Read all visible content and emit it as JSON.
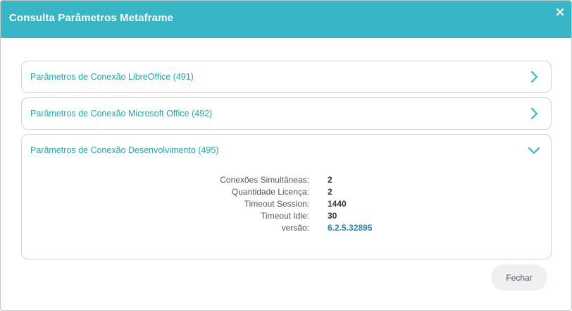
{
  "modal": {
    "title": "Consulta Parâmetros Metaframe",
    "close_icon": "close-icon",
    "accent_color": "#38b6c5"
  },
  "panels": [
    {
      "title": "Parâmetros de Conexão LibreOffice (491)",
      "state": "collapsed",
      "icon": "chevron-right-icon"
    },
    {
      "title": "Parâmetros de Conexão Microsoft Office (492)",
      "state": "collapsed",
      "icon": "chevron-right-icon"
    },
    {
      "title": "Parâmetros de Conexão Desenvolvimento (495)",
      "state": "expanded",
      "icon": "chevron-down-icon",
      "details": [
        {
          "label": "Conexões Simultâneas:",
          "value": "2"
        },
        {
          "label": "Quantidade Licença:",
          "value": "2"
        },
        {
          "label": "Timeout Session:",
          "value": "1440"
        },
        {
          "label": "Timeout Idle:",
          "value": "30"
        },
        {
          "label": "versão:",
          "value": "6.2.5.32895"
        }
      ]
    }
  ],
  "footer": {
    "close_label": "Fechar"
  }
}
